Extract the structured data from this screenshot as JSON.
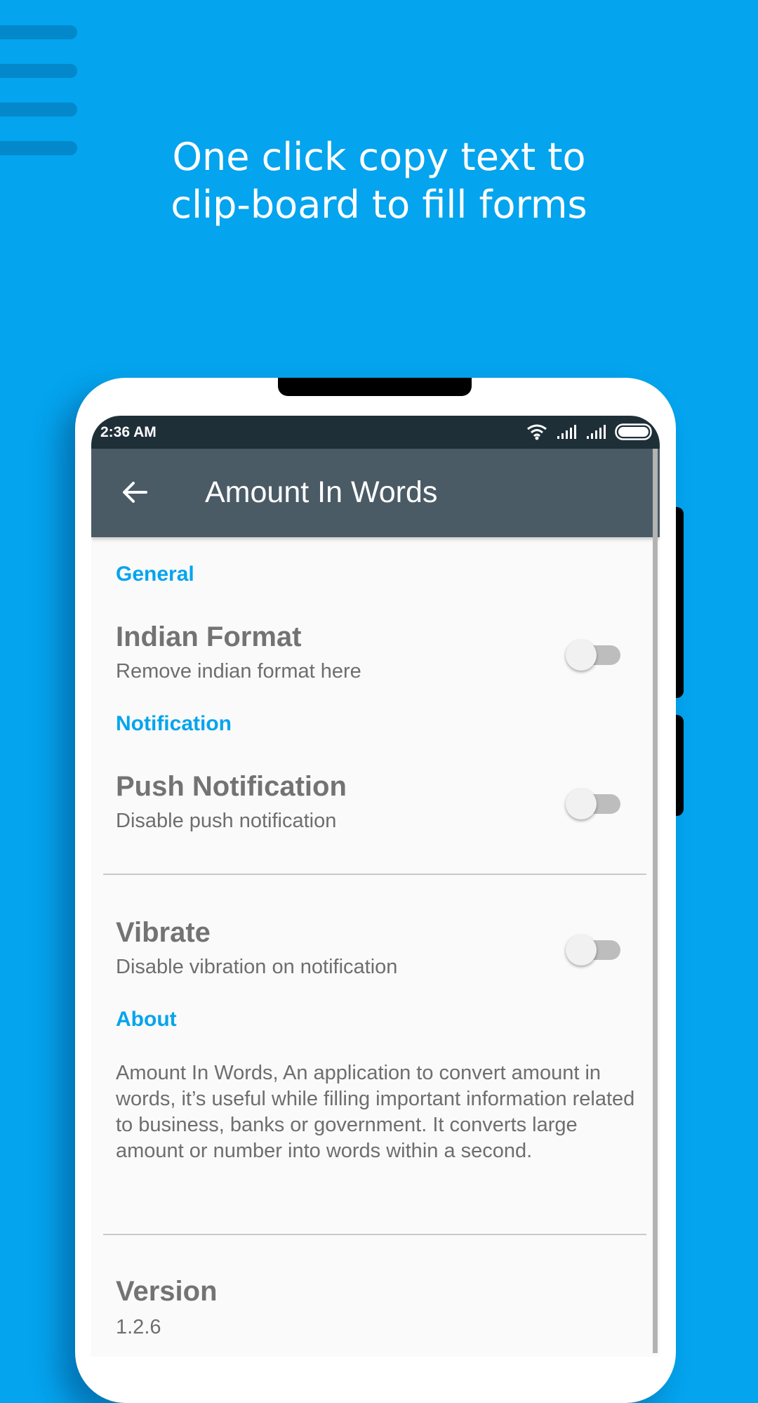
{
  "promo": {
    "headline_line1": "One click copy text to",
    "headline_line2": "clip-board to fill forms"
  },
  "status_bar": {
    "time": "2:36 AM",
    "icons": [
      "wifi-icon",
      "signal-icon",
      "signal-icon",
      "battery-icon"
    ]
  },
  "app_bar": {
    "title": "Amount In Words",
    "back_icon": "arrow-back-icon"
  },
  "settings": {
    "general_header": "General",
    "indian_format_title": "Indian Format",
    "indian_format_summary": "Remove indian format here",
    "indian_format_enabled": false,
    "notification_header": "Notification",
    "push_title": "Push Notification",
    "push_summary": "Disable push notification",
    "push_enabled": false,
    "vibrate_title": "Vibrate",
    "vibrate_summary": "Disable vibration on notification",
    "vibrate_enabled": false,
    "about_header": "About",
    "about_text": "Amount In Words, An application to convert amount in words, it’s useful while filling important information related to business, banks or government. It converts large amount or number into words within a second.",
    "version_title": "Version",
    "version_value": "1.2.6"
  },
  "colors": {
    "background": "#04a4ee",
    "accent": "#04a4ee",
    "app_bar": "#4a5b66",
    "status_bar": "#1f2f38"
  }
}
